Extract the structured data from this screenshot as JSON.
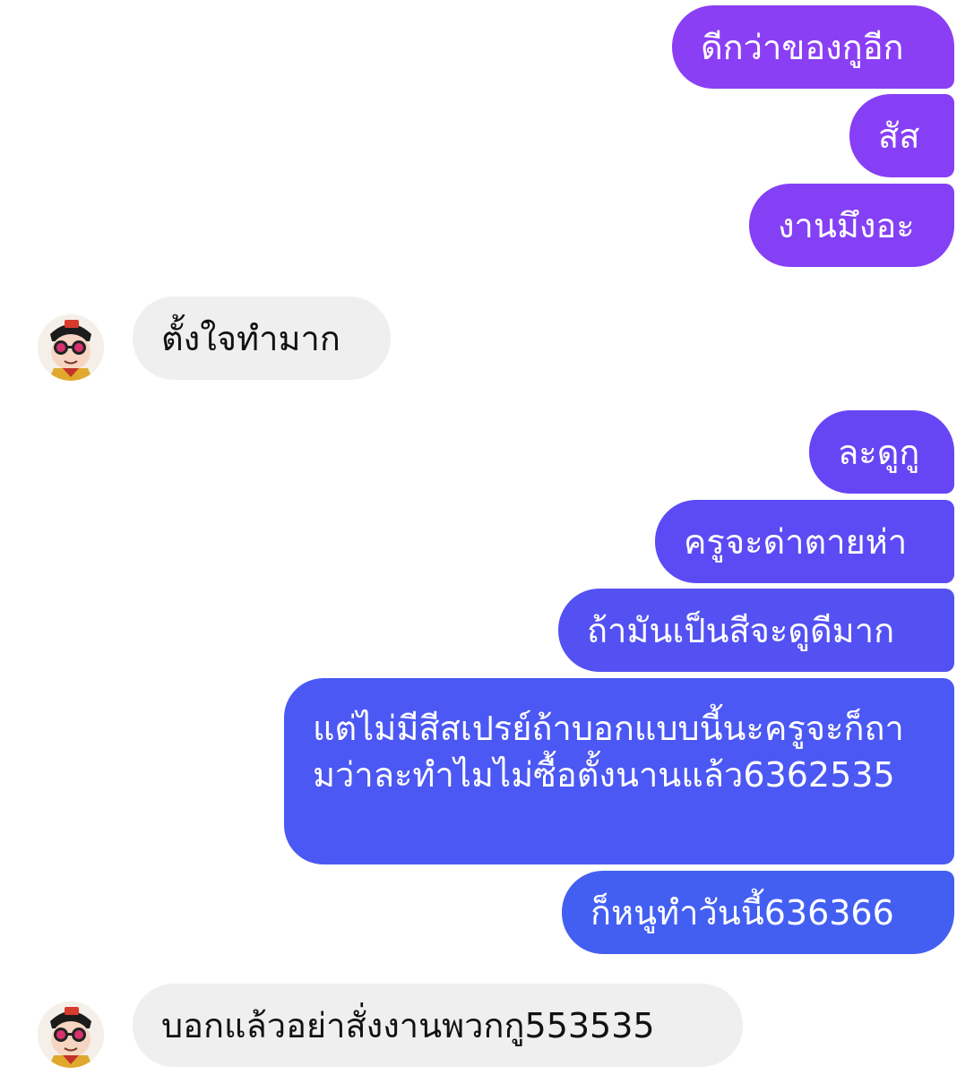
{
  "conversation": {
    "outgoing_group_1": [
      "ดีกว่าของกูอีก",
      "สัส",
      "งานมึงอะ"
    ],
    "incoming_1": "ตั้งใจทำมาก",
    "outgoing_group_2": [
      "ละดูกู",
      "ครูจะด่าตายห่า",
      "ถ้ามันเป็นสีจะดูดีมาก",
      "แต่ไม่มีสีสเปรย์ถ้าบอกแบบนี้นะครูจะก็ถามว่าละทำไมไม่ซื้อตั้งนานแล้ว6362535",
      "ก็หนูทำวันนี้636366"
    ],
    "incoming_2": "บอกแล้วอย่าสั่งงานพวกกู553535"
  },
  "colors": {
    "gradient_top": "#8a3ff5",
    "gradient_bottom": "#3f63f2",
    "incoming_bg": "#efefef"
  },
  "avatar": {
    "icon": "cartoon-avatar-sunglasses-icon"
  }
}
